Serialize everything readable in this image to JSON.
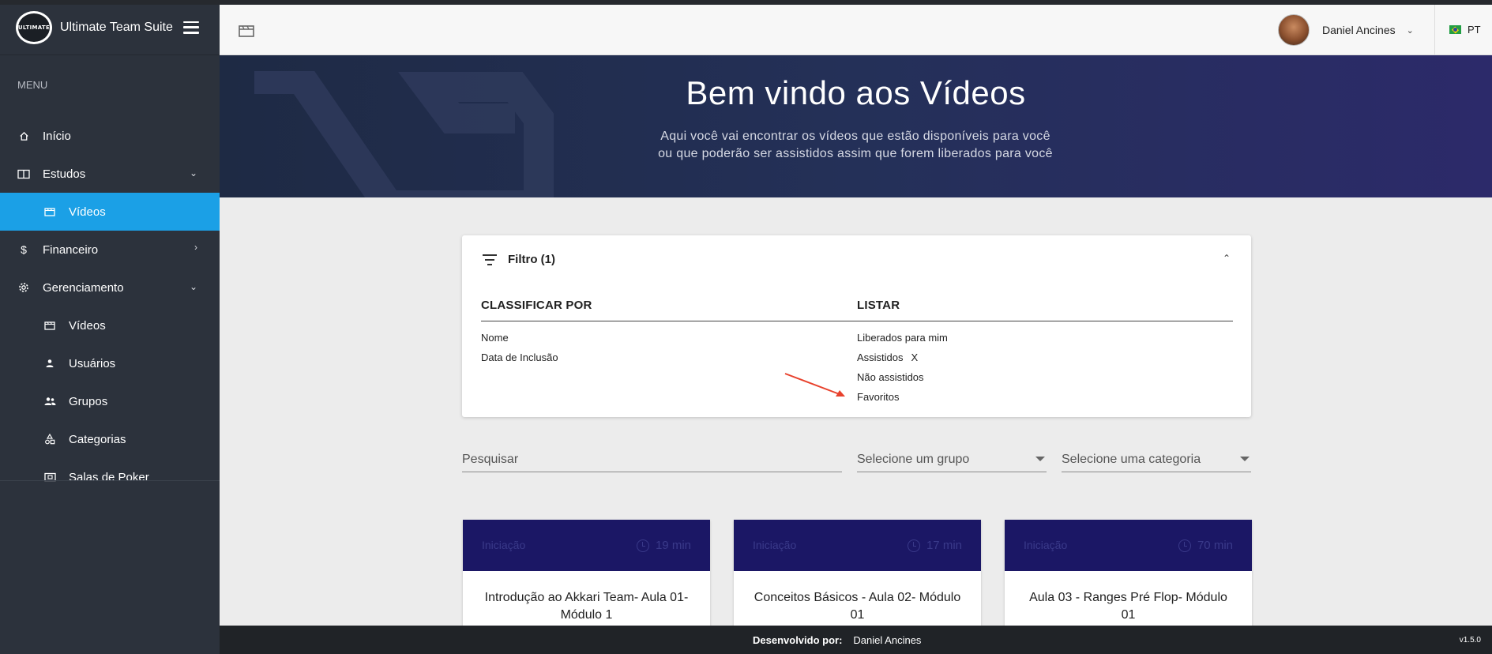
{
  "brand": {
    "title": "Ultimate Team Suite",
    "logo_text": "ULTIMATE"
  },
  "sidebar": {
    "menu_label": "MENU",
    "items": [
      {
        "label": "Início",
        "icon": "home-icon"
      },
      {
        "label": "Estudos",
        "icon": "book-icon",
        "chevron": "expanded"
      },
      {
        "label": "Vídeos",
        "icon": "film-icon",
        "active": true
      },
      {
        "label": "Financeiro",
        "icon": "dollar-icon",
        "chevron": "collapsed"
      },
      {
        "label": "Gerenciamento",
        "icon": "gear-icon",
        "chevron": "expanded"
      },
      {
        "label": "Vídeos",
        "icon": "film-icon"
      },
      {
        "label": "Usuários",
        "icon": "user-icon"
      },
      {
        "label": "Grupos",
        "icon": "group-icon"
      },
      {
        "label": "Categorias",
        "icon": "shapes-icon"
      },
      {
        "label": "Salas de Poker",
        "icon": "ticket-icon"
      }
    ]
  },
  "header": {
    "user_name": "Daniel Ancines",
    "language": "PT"
  },
  "banner": {
    "title": "Bem vindo aos Vídeos",
    "subtitle": "Aqui você vai encontrar os vídeos que estão disponíveis para você ou que poderão ser assistidos assim que forem liberados para você"
  },
  "filter": {
    "title": "Filtro (1)",
    "sort_heading": "CLASSIFICAR POR",
    "sort_options": [
      "Nome",
      "Data de Inclusão"
    ],
    "list_heading": "LISTAR",
    "list_options": [
      "Liberados para mim",
      "Assistidos",
      "Não assistidos",
      "Favoritos"
    ],
    "active_clear": "X"
  },
  "search": {
    "placeholder": "Pesquisar",
    "group_placeholder": "Selecione um grupo",
    "category_placeholder": "Selecione uma categoria"
  },
  "videos": [
    {
      "category": "Iniciação",
      "duration": "19 min",
      "title": "Introdução ao Akkari Team- Aula 01- Módulo 1"
    },
    {
      "category": "Iniciação",
      "duration": "17 min",
      "title": "Conceitos Básicos - Aula 02- Módulo 01"
    },
    {
      "category": "Iniciação",
      "duration": "70 min",
      "title": "Aula 03 - Ranges Pré Flop- Módulo 01"
    }
  ],
  "footer": {
    "developed_by": "Desenvolvido por:",
    "developer": "Daniel Ancines",
    "version": "v1.5.0"
  },
  "colors": {
    "sidebar_bg": "#2c323c",
    "active_item": "#1ba0e6",
    "card_header": "#1b1765",
    "annotation_arrow": "#e8412c"
  }
}
